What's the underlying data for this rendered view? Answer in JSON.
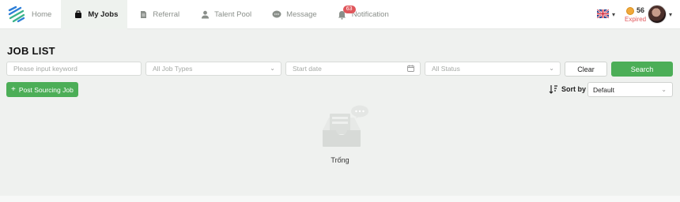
{
  "nav": {
    "items": [
      {
        "label": "Home",
        "icon": "home-icon"
      },
      {
        "label": "My Jobs",
        "icon": "briefcase-icon",
        "active": true
      },
      {
        "label": "Referral",
        "icon": "document-icon"
      },
      {
        "label": "Talent Pool",
        "icon": "person-icon"
      },
      {
        "label": "Message",
        "icon": "chat-icon"
      },
      {
        "label": "Notification",
        "icon": "bell-icon",
        "badge": "63"
      }
    ]
  },
  "account": {
    "language_flag": "uk-flag-icon",
    "coins": "56",
    "status": "Expired"
  },
  "page": {
    "title": "JOB LIST"
  },
  "filters": {
    "keyword_placeholder": "Please input keyword",
    "job_type_placeholder": "All Job Types",
    "start_date_placeholder": "Start date",
    "status_placeholder": "All Status",
    "clear_label": "Clear",
    "search_label": "Search"
  },
  "actions": {
    "post_label": "Post Sourcing Job"
  },
  "sort": {
    "label": "Sort by",
    "selected": "Default"
  },
  "empty": {
    "text": "Trống"
  },
  "colors": {
    "primary": "#4cae57",
    "badge": "#e0565b",
    "background": "#eff1ef"
  }
}
